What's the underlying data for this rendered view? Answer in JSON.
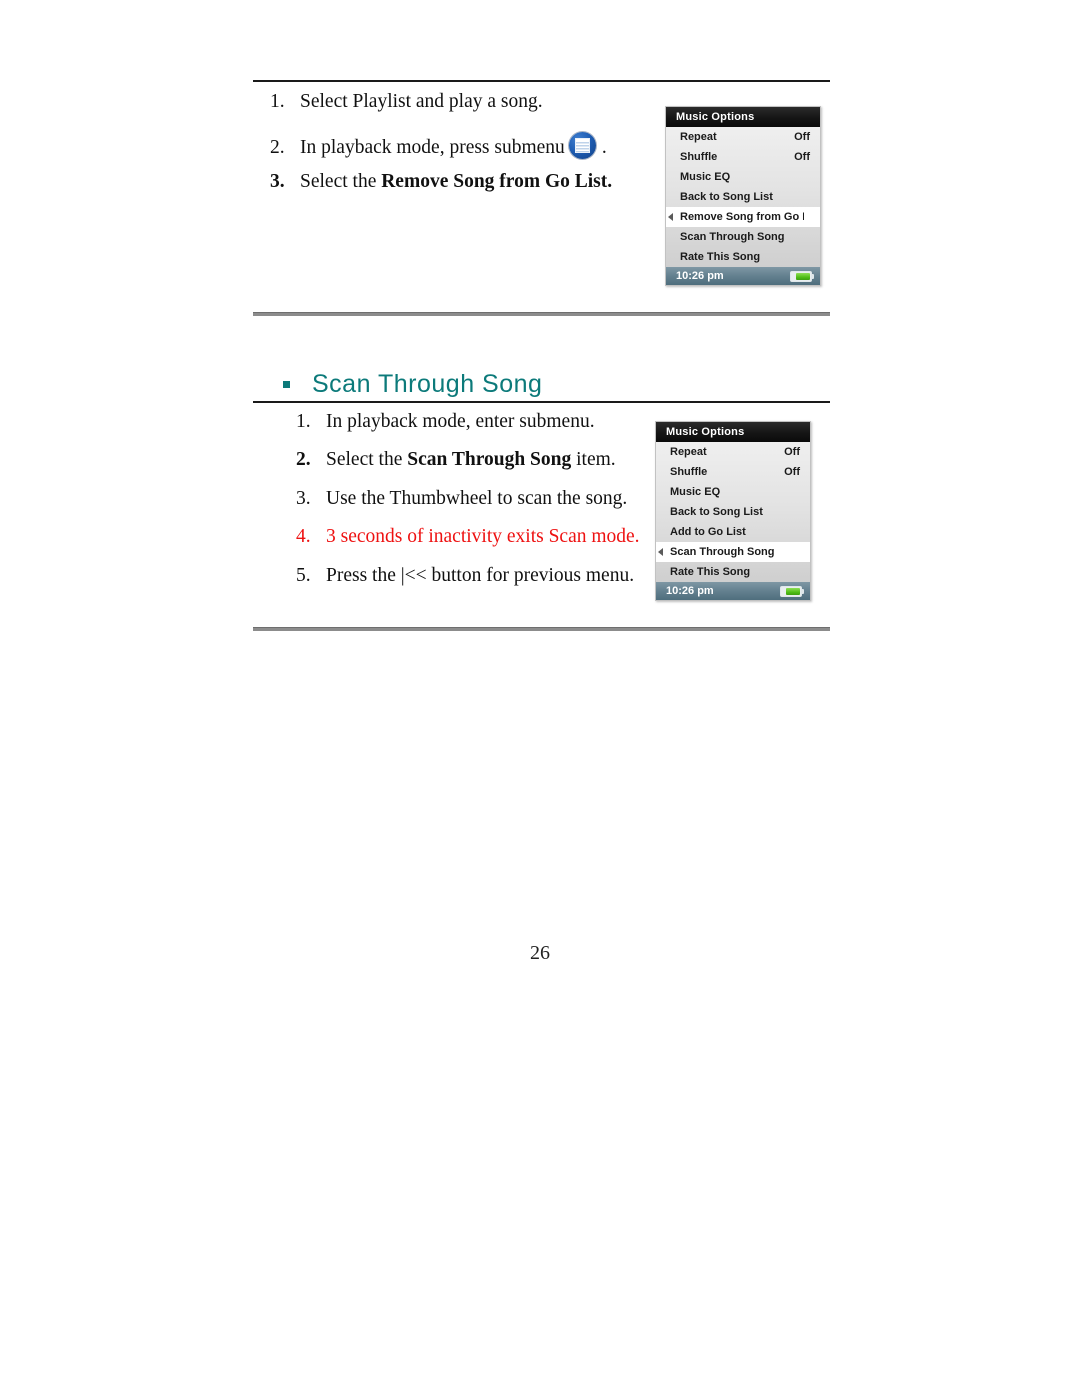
{
  "document": {
    "page_number": "26"
  },
  "section_one": {
    "steps": [
      {
        "num": "1.",
        "text": "Select Playlist and play a song.",
        "bold": false,
        "red": false
      },
      {
        "num": "2.",
        "text": "In playback mode, press submenu",
        "bold": false,
        "red": false,
        "icon": "submenu-icon",
        "suffix": "."
      },
      {
        "num": "3.",
        "prefix": "Select the ",
        "bold_part": "Remove Song from Go List.",
        "bold": true,
        "red": false
      }
    ],
    "device": {
      "title": "Music Options",
      "rows": [
        {
          "label": "Repeat",
          "value": "Off",
          "selected": false
        },
        {
          "label": "Shuffle",
          "value": "Off",
          "selected": false
        },
        {
          "label": "Music EQ",
          "value": "",
          "selected": false
        },
        {
          "label": "Back to Song List",
          "value": "",
          "selected": false
        },
        {
          "label": "Remove Song from Go Lis",
          "value": "",
          "selected": true
        },
        {
          "label": "Scan Through Song",
          "value": "",
          "selected": false
        },
        {
          "label": "Rate This Song",
          "value": "",
          "selected": false
        }
      ],
      "status_time": "10:26 pm",
      "battery": "charged"
    }
  },
  "section_two": {
    "heading": "Scan Through Song",
    "heading_color": "#0c7a7a",
    "steps": [
      {
        "num": "1.",
        "text": "In playback mode, enter submenu.",
        "bold": false,
        "red": false
      },
      {
        "num": "2.",
        "prefix": "Select the ",
        "bold_part": "Scan Through Song",
        "suffix": " item.",
        "bold": true,
        "red": false
      },
      {
        "num": "3.",
        "text": "Use the Thumbwheel to scan the song.",
        "bold": false,
        "red": false
      },
      {
        "num": "4.",
        "text": "3 seconds of inactivity exits Scan mode.",
        "bold": false,
        "red": true
      },
      {
        "num": "5.",
        "text": "Press the |<< button for previous menu.",
        "bold": false,
        "red": false
      }
    ],
    "device": {
      "title": "Music Options",
      "rows": [
        {
          "label": "Repeat",
          "value": "Off",
          "selected": false
        },
        {
          "label": "Shuffle",
          "value": "Off",
          "selected": false
        },
        {
          "label": "Music EQ",
          "value": "",
          "selected": false
        },
        {
          "label": "Back to Song List",
          "value": "",
          "selected": false
        },
        {
          "label": "Add to Go List",
          "value": "",
          "selected": false
        },
        {
          "label": "Scan Through Song",
          "value": "",
          "selected": true
        },
        {
          "label": "Rate This Song",
          "value": "",
          "selected": false
        }
      ],
      "status_time": "10:26 pm",
      "battery": "charged"
    }
  },
  "colors": {
    "red_note": "#ee1111",
    "heading_teal": "#0c7a7a",
    "rule_dark": "#1a1a1a",
    "rule_gray": "#8c8c8c"
  }
}
